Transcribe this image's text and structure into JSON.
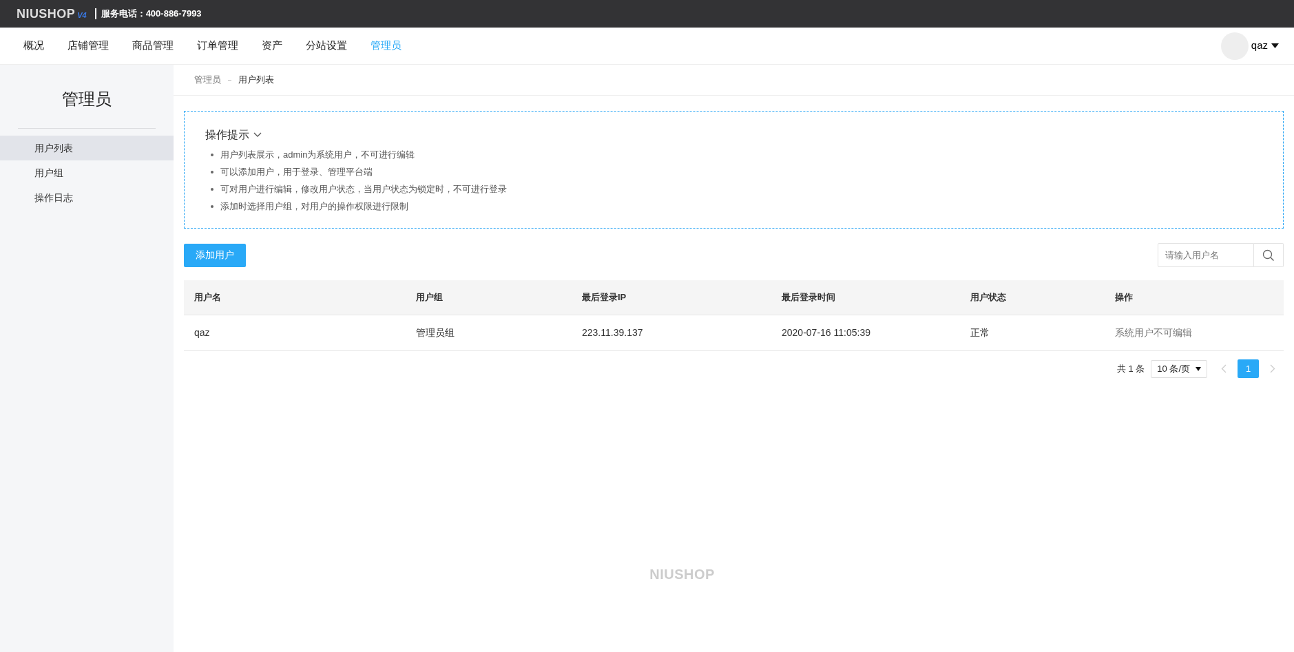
{
  "topbar": {
    "logo": "NIUSHOP",
    "version": "V4",
    "phone": "服务电话：400-886-7993"
  },
  "nav": {
    "items": [
      {
        "label": "概况",
        "selected": false
      },
      {
        "label": "店铺管理",
        "selected": false
      },
      {
        "label": "商品管理",
        "selected": false
      },
      {
        "label": "订单管理",
        "selected": false
      },
      {
        "label": "资产",
        "selected": false
      },
      {
        "label": "分站设置",
        "selected": false
      },
      {
        "label": "管理员",
        "selected": true
      }
    ],
    "user": "qaz"
  },
  "sidebar": {
    "title": "管理员",
    "items": [
      {
        "label": "用户列表",
        "selected": true
      },
      {
        "label": "用户组",
        "selected": false
      },
      {
        "label": "操作日志",
        "selected": false
      }
    ]
  },
  "breadcrumb": [
    "管理员",
    "用户列表"
  ],
  "tips": {
    "title": "操作提示",
    "items": [
      "用户列表展示，admin为系统用户，不可进行编辑",
      "可以添加用户，用于登录、管理平台端",
      "可对用户进行编辑，修改用户状态，当用户状态为锁定时，不可进行登录",
      "添加时选择用户组，对用户的操作权限进行限制"
    ]
  },
  "add_button": "添加用户",
  "search": {
    "placeholder": "请输入用户名"
  },
  "table": {
    "columns": [
      "用户名",
      "用户组",
      "最后登录IP",
      "最后登录时间",
      "用户状态",
      "操作"
    ],
    "rows": [
      [
        "qaz",
        "管理员组",
        "223.11.39.137",
        "2020-07-16 11:05:39",
        "正常",
        "系统用户不可编辑"
      ]
    ]
  },
  "pagination": {
    "total": "共 1 条",
    "page_size": "10 条/页",
    "pages": [
      {
        "label": "1",
        "selected": true
      }
    ]
  },
  "footer": {
    "logo": "NIUSHOP"
  }
}
